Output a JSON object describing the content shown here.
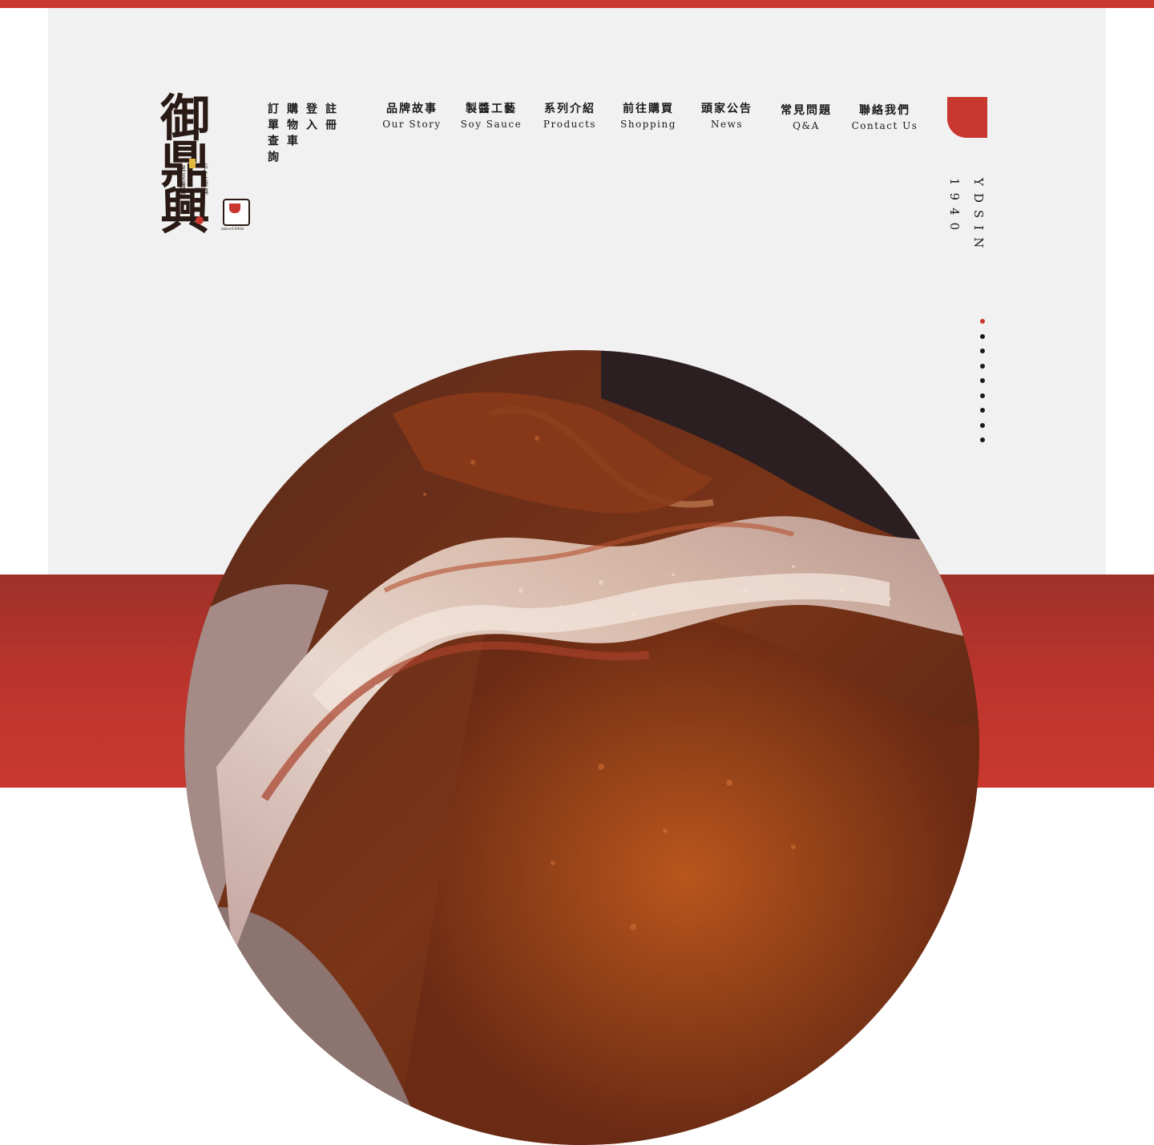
{
  "brand": {
    "logo_text": [
      "御",
      "鼎",
      "興"
    ],
    "logo_tagline_1": "手工柴燒",
    "logo_tagline_2": "黑豆醬油",
    "logo_seal_text": "since1940s",
    "vertical_name": "YDSIN",
    "vertical_year": "1940"
  },
  "account": {
    "register": "註冊",
    "login": "登入",
    "cart": "購物車",
    "orders": "訂單查詢"
  },
  "nav": [
    {
      "zh": "品牌故事",
      "en": "Our Story"
    },
    {
      "zh": "製醬工藝",
      "en": "Soy Sauce"
    },
    {
      "zh": "系列介紹",
      "en": "Products"
    },
    {
      "zh": "前往購買",
      "en": "Shopping"
    },
    {
      "zh": "頭家公告",
      "en": "News"
    },
    {
      "zh": "常見問題",
      "en": "Q&A"
    },
    {
      "zh": "聯絡我們",
      "en": "Contact Us"
    }
  ],
  "slider": {
    "count": 9,
    "active_index": 0
  },
  "colors": {
    "accent": "#c9382f",
    "panel": "#f1f1f1",
    "text": "#1a1a1a"
  },
  "icons": {
    "corner_tab": "corner-tab-icon",
    "hero": "soy-crystal-photo"
  }
}
